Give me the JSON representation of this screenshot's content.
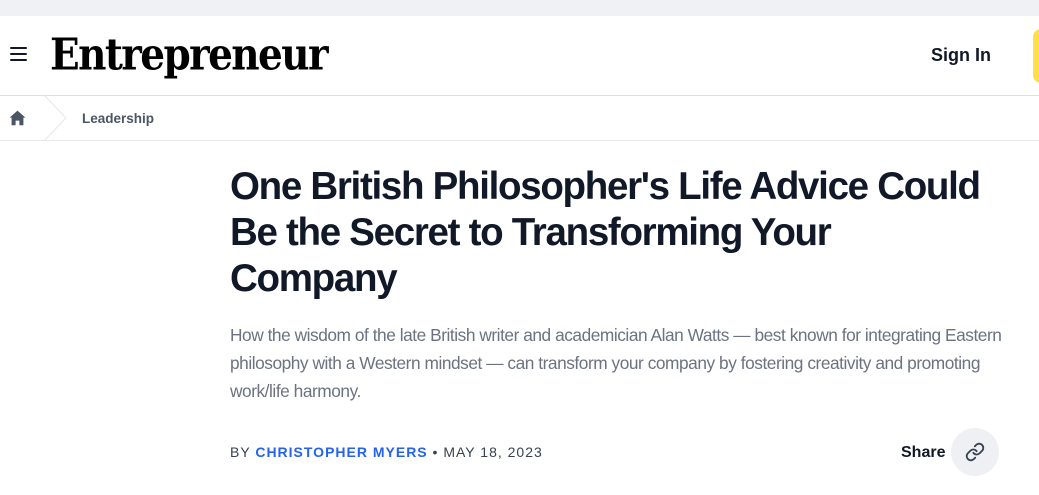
{
  "header": {
    "menu_icon": "hamburger-menu-icon",
    "logo_text": "Entrepreneur",
    "sign_in_label": "Sign In",
    "accent_color": "#fde047"
  },
  "breadcrumb": {
    "home_icon": "home-icon",
    "items": [
      {
        "label": "Leadership"
      }
    ]
  },
  "article": {
    "headline": "One British Philosopher's Life Advice Could Be the Secret to Transforming Your Company",
    "subhead": "How the wisdom of the late British writer and academician Alan Watts — best known for integrating Eastern philosophy with a Western mindset — can transform your company by fostering creativity and promoting work/life harmony.",
    "byline": {
      "prefix": "BY",
      "author": "CHRISTOPHER MYERS",
      "separator": "•",
      "date": "MAY 18, 2023",
      "author_color": "#2563eb"
    },
    "share": {
      "label": "Share",
      "icon": "link-icon"
    }
  }
}
